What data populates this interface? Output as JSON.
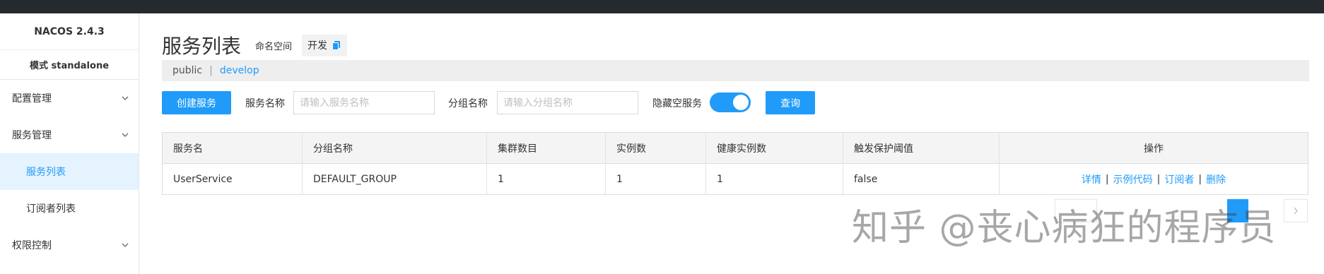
{
  "app": {
    "brand": "NACOS 2.4.3",
    "mode": "模式 standalone"
  },
  "sidebar": {
    "items": [
      {
        "label": "配置管理"
      },
      {
        "label": "服务管理"
      },
      {
        "label": "服务列表"
      },
      {
        "label": "订阅者列表"
      },
      {
        "label": "权限控制"
      }
    ]
  },
  "header": {
    "title": "服务列表",
    "namespace_label": "命名空间",
    "namespace_value": "开发"
  },
  "namespaces": {
    "items": [
      "public",
      "develop"
    ],
    "separator": "|"
  },
  "filters": {
    "create_button": "创建服务",
    "service_name_label": "服务名称",
    "service_name_placeholder": "请输入服务名称",
    "group_name_label": "分组名称",
    "group_name_placeholder": "请输入分组名称",
    "hide_empty_label": "隐藏空服务",
    "hide_empty_on": true,
    "query_button": "查询"
  },
  "table": {
    "columns": [
      "服务名",
      "分组名称",
      "集群数目",
      "实例数",
      "健康实例数",
      "触发保护阈值",
      "操作"
    ],
    "rows": [
      {
        "service": "UserService",
        "group": "DEFAULT_GROUP",
        "clusters": "1",
        "instances": "1",
        "healthy": "1",
        "protect": "false",
        "actions": [
          "详情",
          "示例代码",
          "订阅者",
          "删除"
        ]
      }
    ],
    "action_separator": "|"
  },
  "watermark": "知乎 @丧心病狂的程序员",
  "colors": {
    "accent": "#209bfa",
    "topbar": "#252a2f",
    "active_bg": "#e4f3fe"
  }
}
